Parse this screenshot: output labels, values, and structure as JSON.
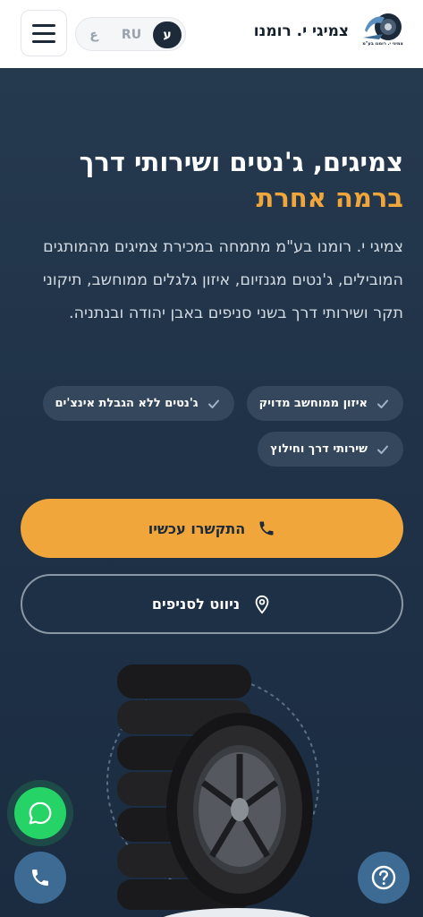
{
  "header": {
    "brand_name": "צמיגי י. רומנו",
    "logo_text": "צמיגי י. רומנו בע\"מ",
    "menu_icon": "hamburger-icon",
    "languages": [
      {
        "code": "ar",
        "label": "ع",
        "active": false
      },
      {
        "code": "ru",
        "label": "RU",
        "active": false
      },
      {
        "code": "he",
        "label": "ע",
        "active": true
      }
    ]
  },
  "hero": {
    "title_line1": "צמיגים, ג'נטים ושירותי דרך",
    "title_line2": "ברמה אחרת",
    "description": "צמיגי י. רומנו בע\"מ מתמחה במכירת צמיגים מהמותגים המובילים, ג'נטים מגנזיום, איזון גלגלים ממוחשב, תיקוני תקר ושירותי דרך בשני סניפים באבן יהודה ובנתניה.",
    "chips": [
      {
        "label": "איזון ממוחשב מדויק",
        "icon": "check-icon"
      },
      {
        "label": "ג'נטים ללא הגבלת אינצ'ים",
        "icon": "check-icon"
      },
      {
        "label": "שירותי דרך וחילוץ",
        "icon": "check-icon"
      }
    ],
    "call_button": {
      "label": "התקשרו עכשיו",
      "icon": "phone-icon"
    },
    "nav_button": {
      "label": "ניווט לסניפים",
      "icon": "location-pin-icon"
    },
    "image": "tire-stack-image"
  },
  "floating": {
    "whatsapp_icon": "whatsapp-icon",
    "phone_icon": "phone-icon",
    "help_icon": "help-icon"
  },
  "colors": {
    "accent": "#f0a63a",
    "background": "#1f3147",
    "chip_bg": "#34475c",
    "whatsapp": "#25d366",
    "fab_blue": "#3d6b94"
  }
}
